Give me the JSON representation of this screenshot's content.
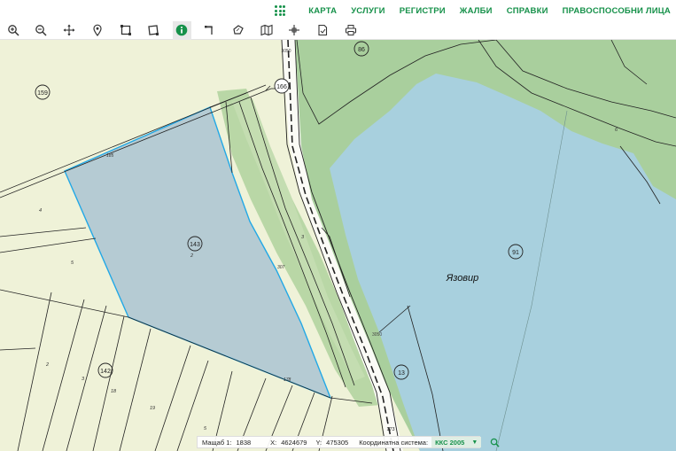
{
  "nav": {
    "apps_icon": "grid-apps-icon",
    "items": [
      {
        "label": "КАРТА"
      },
      {
        "label": "УСЛУГИ"
      },
      {
        "label": "РЕГИСТРИ"
      },
      {
        "label": "ЖАЛБИ"
      },
      {
        "label": "СПРАВКИ"
      },
      {
        "label": "ПРАВОСПОСОБНИ ЛИЦА"
      }
    ],
    "color": "#16914a"
  },
  "toolbar": {
    "tools": [
      "zoom-in-icon",
      "zoom-out-icon",
      "pan-icon",
      "location-pin-icon",
      "select-rectangle-icon",
      "select-polygon-icon",
      "info-icon",
      "measure-distance-icon",
      "measure-area-icon",
      "layers-map-icon",
      "crosshair-icon",
      "document-icon",
      "print-icon"
    ],
    "active_tool": "info-icon"
  },
  "map": {
    "parcel_numbers": [
      "159",
      "166",
      "86",
      "143",
      "91",
      "142",
      "13",
      "173"
    ],
    "small_labels": [
      "3050",
      "185",
      "4",
      "5",
      "2",
      "3",
      "307",
      "6",
      "178",
      "2",
      "3",
      "18",
      "19",
      "5",
      "3050"
    ],
    "water_label": "Язовир",
    "colors": {
      "field": "#eff2d8",
      "forest": "#a9cf9d",
      "water": "#a8d0de",
      "selected_parcel": "#b5cbd3",
      "selected_border": "#22a8e6",
      "road": "#fbfbf6"
    }
  },
  "status": {
    "scale_label": "Мащаб 1:",
    "scale_value": "1838",
    "x_label": "X:",
    "x_value": "4624679",
    "y_label": "Y:",
    "y_value": "475305",
    "crs_label": "Координатна система:",
    "crs_value": "ККС 2005",
    "search_icon": "search-icon"
  }
}
